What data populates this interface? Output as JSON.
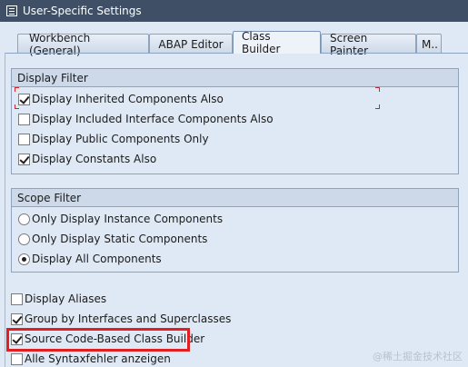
{
  "window": {
    "title": "User-Specific Settings"
  },
  "tabs": [
    {
      "label": "Workbench (General)",
      "active": false
    },
    {
      "label": "ABAP Editor",
      "active": false
    },
    {
      "label": "Class Builder",
      "active": true
    },
    {
      "label": "Screen Painter",
      "active": false
    },
    {
      "label": "M..",
      "active": false
    }
  ],
  "display_filter": {
    "title": "Display Filter",
    "options": [
      {
        "label": "Display Inherited Components Also",
        "checked": true
      },
      {
        "label": "Display Included Interface Components Also",
        "checked": false
      },
      {
        "label": "Display Public Components Only",
        "checked": false
      },
      {
        "label": "Display Constants Also",
        "checked": true
      }
    ]
  },
  "scope_filter": {
    "title": "Scope Filter",
    "options": [
      {
        "label": "Only Display Instance Components",
        "selected": false
      },
      {
        "label": "Only Display Static Components",
        "selected": false
      },
      {
        "label": "Display All Components",
        "selected": true
      }
    ]
  },
  "other_options": [
    {
      "label": "Display Aliases",
      "checked": false
    },
    {
      "label": "Group by Interfaces and Superclasses",
      "checked": true
    },
    {
      "label": "Source Code-Based Class Builder",
      "checked": true
    },
    {
      "label": "Alle Syntaxfehler anzeigen",
      "checked": false
    }
  ],
  "watermark": "@稀土掘金技术社区",
  "colors": {
    "titlebar": "#3e4f66",
    "background": "#dfe9f5",
    "highlight": "#e02020"
  }
}
